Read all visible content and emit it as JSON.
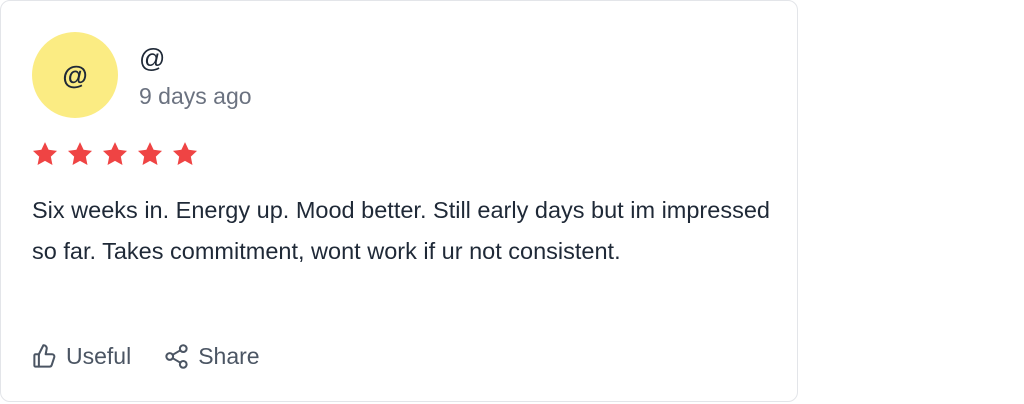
{
  "review": {
    "avatar_text": "@",
    "author": "@",
    "time_ago": "9 days ago",
    "rating": 5,
    "rating_max": 5,
    "body": "Six weeks in. Energy up. Mood better. Still early days but im impressed so far. Takes commitment, wont work if ur not consistent.",
    "actions": {
      "useful_label": "Useful",
      "share_label": "Share",
      "useful_icon": "thumbs-up-icon",
      "share_icon": "share-icon"
    },
    "colors": {
      "star": "#ef4444",
      "avatar_bg": "#fbec83"
    }
  }
}
